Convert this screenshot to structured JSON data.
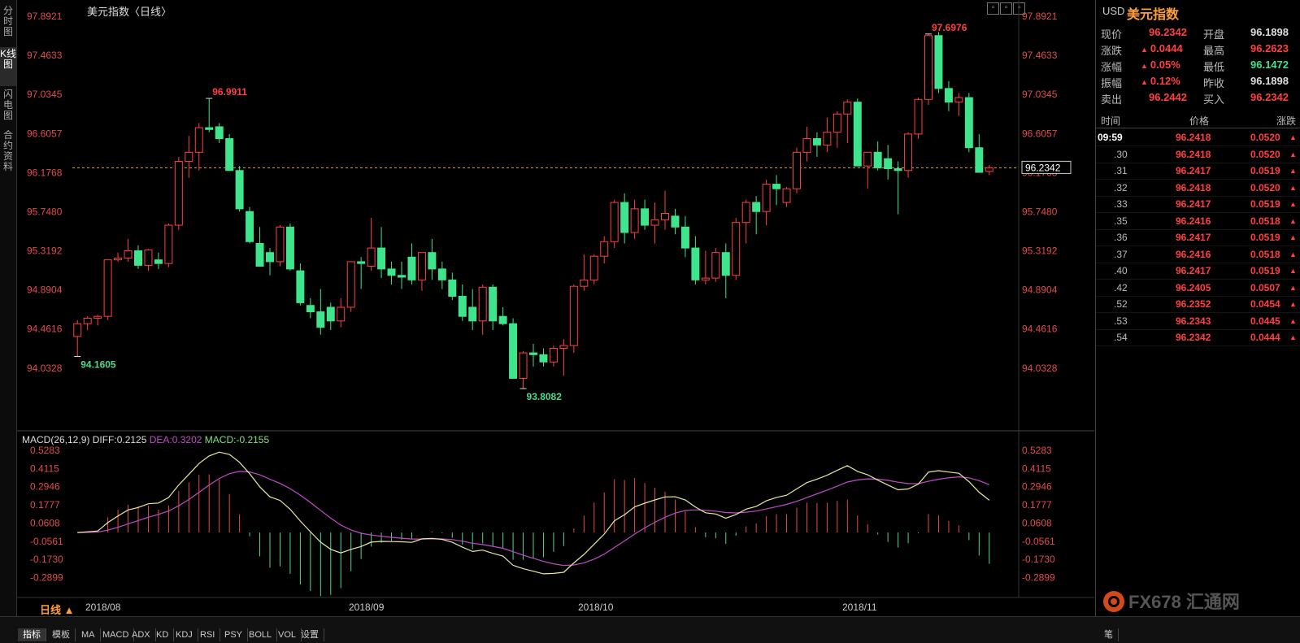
{
  "window": {
    "title": "美元指数〈日线〉"
  },
  "left_tabs": [
    {
      "label": "分时图",
      "active": false
    },
    {
      "label": "K线图",
      "active": true
    },
    {
      "label": "闪电图",
      "active": false
    },
    {
      "label": "合约资料",
      "active": false
    }
  ],
  "price_axis": {
    "ticks": [
      "97.8921",
      "97.4633",
      "97.0345",
      "96.6057",
      "96.1768",
      "95.7480",
      "95.3192",
      "94.8904",
      "94.4616",
      "94.0328"
    ],
    "current_price_tag": "96.2342"
  },
  "macd": {
    "label": "MACD(26,12,9)",
    "diff": "DIFF:0.2125",
    "dea": "DEA:0.3202",
    "macd": "MACD:-0.2155",
    "ticks": [
      "0.5283",
      "0.4115",
      "0.2946",
      "0.1777",
      "0.0608",
      "-0.0561",
      "-0.1730",
      "-0.2899"
    ]
  },
  "markers": {
    "high1": "96.9911",
    "low1": "94.1605",
    "low2": "93.8082",
    "high2": "97.6976"
  },
  "x_axis": {
    "period": "日线",
    "labels": [
      "2018/08",
      "2018/09",
      "2018/10",
      "2018/11"
    ]
  },
  "bottom_tabs": [
    "指标",
    "模板",
    "MA",
    "MACD",
    "ADX",
    "KD",
    "KDJ",
    "RSI",
    "PSY",
    "BOLL",
    "VOL",
    "设置"
  ],
  "quote": {
    "symbol": "USD",
    "name": "美元指数",
    "rows": [
      {
        "l1": "现价",
        "v1": "96.2342",
        "c1": "red",
        "l2": "开盘",
        "v2": "96.1898",
        "c2": "white"
      },
      {
        "l1": "涨跌",
        "v1": "0.0444",
        "c1": "red",
        "l2": "最高",
        "v2": "96.2623",
        "c2": "red"
      },
      {
        "l1": "涨幅",
        "v1": "0.05%",
        "c1": "red",
        "l2": "最低",
        "v2": "96.1472",
        "c2": "green"
      },
      {
        "l1": "振幅",
        "v1": "0.12%",
        "c1": "red",
        "l2": "昨收",
        "v2": "96.1898",
        "c2": "white"
      },
      {
        "l1": "卖出",
        "v1": "96.2442",
        "c1": "red",
        "l2": "买入",
        "v2": "96.2342",
        "c2": "red"
      }
    ]
  },
  "ticks_table": {
    "headers": [
      "时间",
      "价格",
      "涨跌"
    ],
    "rows": [
      {
        "time": "09:59",
        "price": "96.2418",
        "chg": "0.0520"
      },
      {
        "time": ".30",
        "price": "96.2418",
        "chg": "0.0520"
      },
      {
        "time": ".31",
        "price": "96.2417",
        "chg": "0.0519"
      },
      {
        "time": ".32",
        "price": "96.2418",
        "chg": "0.0520"
      },
      {
        "time": ".33",
        "price": "96.2417",
        "chg": "0.0519"
      },
      {
        "time": ".35",
        "price": "96.2416",
        "chg": "0.0518"
      },
      {
        "time": ".36",
        "price": "96.2417",
        "chg": "0.0519"
      },
      {
        "time": ".37",
        "price": "96.2416",
        "chg": "0.0518"
      },
      {
        "time": ".40",
        "price": "96.2417",
        "chg": "0.0519"
      },
      {
        "time": ".42",
        "price": "96.2405",
        "chg": "0.0507"
      },
      {
        "time": ".52",
        "price": "96.2352",
        "chg": "0.0454"
      },
      {
        "time": ".53",
        "price": "96.2343",
        "chg": "0.0445"
      },
      {
        "time": ".54",
        "price": "96.2342",
        "chg": "0.0444"
      }
    ]
  },
  "right_bottom_tab": "笔",
  "logo_text": "FX678 汇通网",
  "colors": {
    "up": "#ff4040",
    "down": "#3fe58c",
    "dea": "#c04cc8",
    "diff": "#e8e8a0"
  },
  "chart_data": {
    "type": "candlestick",
    "price_ylim": [
      93.8082,
      97.8921
    ],
    "candles": [
      [
        94.38,
        94.56,
        94.16,
        94.52
      ],
      [
        94.52,
        94.6,
        94.45,
        94.58
      ],
      [
        94.58,
        94.62,
        94.5,
        94.6
      ],
      [
        94.6,
        95.22,
        94.56,
        95.22
      ],
      [
        95.22,
        95.3,
        95.2,
        95.24
      ],
      [
        95.24,
        95.45,
        95.2,
        95.32
      ],
      [
        95.32,
        95.38,
        95.12,
        95.16
      ],
      [
        95.16,
        95.34,
        95.1,
        95.33
      ],
      [
        95.22,
        95.3,
        95.12,
        95.18
      ],
      [
        95.18,
        95.62,
        95.14,
        95.6
      ],
      [
        95.6,
        96.35,
        95.55,
        96.3
      ],
      [
        96.3,
        96.58,
        96.12,
        96.4
      ],
      [
        96.4,
        96.72,
        96.2,
        96.67
      ],
      [
        96.67,
        96.99,
        96.62,
        96.65
      ],
      [
        96.68,
        96.72,
        96.5,
        96.55
      ],
      [
        96.55,
        96.6,
        96.2,
        96.2
      ],
      [
        96.2,
        96.25,
        95.75,
        95.78
      ],
      [
        95.75,
        95.8,
        95.4,
        95.42
      ],
      [
        95.4,
        95.58,
        95.15,
        95.15
      ],
      [
        95.3,
        95.35,
        95.05,
        95.2
      ],
      [
        95.2,
        95.6,
        95.15,
        95.58
      ],
      [
        95.58,
        95.62,
        95.1,
        95.12
      ],
      [
        95.1,
        95.18,
        94.72,
        94.75
      ],
      [
        94.72,
        94.8,
        94.58,
        94.65
      ],
      [
        94.65,
        94.9,
        94.4,
        94.48
      ],
      [
        94.7,
        94.75,
        94.45,
        94.55
      ],
      [
        94.55,
        94.8,
        94.48,
        94.7
      ],
      [
        94.7,
        95.2,
        94.65,
        95.2
      ],
      [
        95.2,
        95.25,
        94.9,
        95.18
      ],
      [
        95.15,
        95.68,
        95.1,
        95.35
      ],
      [
        95.35,
        95.58,
        95.02,
        95.12
      ],
      [
        95.12,
        95.2,
        94.95,
        95.05
      ],
      [
        95.05,
        95.2,
        94.9,
        95.03
      ],
      [
        95.25,
        95.4,
        94.95,
        95.0
      ],
      [
        95.0,
        95.3,
        94.88,
        95.3
      ],
      [
        95.3,
        95.45,
        95.0,
        95.12
      ],
      [
        95.12,
        95.2,
        94.9,
        95.0
      ],
      [
        95.0,
        95.08,
        94.78,
        94.82
      ],
      [
        94.82,
        94.95,
        94.55,
        94.6
      ],
      [
        94.7,
        94.9,
        94.45,
        94.55
      ],
      [
        94.55,
        94.95,
        94.4,
        94.92
      ],
      [
        94.92,
        94.95,
        94.45,
        94.55
      ],
      [
        94.6,
        94.7,
        94.5,
        94.52
      ],
      [
        94.52,
        94.58,
        94.0,
        93.92
      ],
      [
        93.92,
        94.22,
        93.81,
        94.2
      ],
      [
        94.2,
        94.3,
        94.05,
        94.18
      ],
      [
        94.18,
        94.25,
        94.05,
        94.1
      ],
      [
        94.1,
        94.28,
        94.05,
        94.25
      ],
      [
        94.25,
        94.35,
        93.95,
        94.28
      ],
      [
        94.28,
        94.95,
        94.2,
        94.93
      ],
      [
        94.93,
        95.28,
        94.88,
        95.0
      ],
      [
        95.0,
        95.28,
        94.95,
        95.26
      ],
      [
        95.26,
        95.48,
        95.18,
        95.42
      ],
      [
        95.42,
        95.88,
        95.35,
        95.85
      ],
      [
        95.85,
        95.95,
        95.4,
        95.52
      ],
      [
        95.52,
        95.88,
        95.45,
        95.78
      ],
      [
        95.78,
        95.88,
        95.55,
        95.6
      ],
      [
        95.6,
        95.85,
        95.4,
        95.66
      ],
      [
        95.66,
        95.98,
        95.55,
        95.73
      ],
      [
        95.7,
        95.78,
        95.5,
        95.58
      ],
      [
        95.58,
        95.7,
        95.25,
        95.35
      ],
      [
        95.35,
        95.48,
        94.95,
        95.0
      ],
      [
        95.0,
        95.32,
        94.95,
        95.02
      ],
      [
        95.02,
        95.35,
        94.98,
        95.3
      ],
      [
        95.3,
        95.4,
        94.8,
        95.05
      ],
      [
        95.05,
        95.68,
        95.0,
        95.63
      ],
      [
        95.63,
        95.88,
        95.4,
        95.85
      ],
      [
        95.85,
        95.92,
        95.5,
        95.75
      ],
      [
        95.75,
        96.1,
        95.6,
        96.05
      ],
      [
        96.05,
        96.15,
        95.82,
        96.0
      ],
      [
        95.85,
        96.02,
        95.8,
        96.0
      ],
      [
        96.0,
        96.45,
        95.95,
        96.4
      ],
      [
        96.4,
        96.68,
        96.3,
        96.55
      ],
      [
        96.55,
        96.62,
        96.35,
        96.48
      ],
      [
        96.48,
        96.78,
        96.4,
        96.62
      ],
      [
        96.62,
        96.85,
        96.45,
        96.82
      ],
      [
        96.82,
        96.98,
        96.5,
        96.95
      ],
      [
        96.95,
        96.99,
        96.4,
        96.25
      ],
      [
        96.25,
        96.4,
        96.0,
        96.4
      ],
      [
        96.4,
        96.52,
        96.2,
        96.23
      ],
      [
        96.33,
        96.48,
        96.1,
        96.22
      ],
      [
        96.22,
        96.3,
        95.72,
        96.2
      ],
      [
        96.2,
        96.62,
        96.12,
        96.6
      ],
      [
        96.6,
        97.0,
        96.55,
        96.98
      ],
      [
        96.98,
        97.7,
        96.92,
        97.68
      ],
      [
        97.68,
        97.72,
        97.05,
        97.1
      ],
      [
        97.1,
        97.18,
        96.85,
        96.95
      ],
      [
        96.95,
        97.05,
        96.8,
        97.0
      ],
      [
        97.0,
        97.05,
        96.4,
        96.45
      ],
      [
        96.45,
        96.6,
        96.2,
        96.18
      ],
      [
        96.19,
        96.26,
        96.15,
        96.23
      ]
    ],
    "macd_ylim": [
      -0.35,
      0.56
    ]
  }
}
